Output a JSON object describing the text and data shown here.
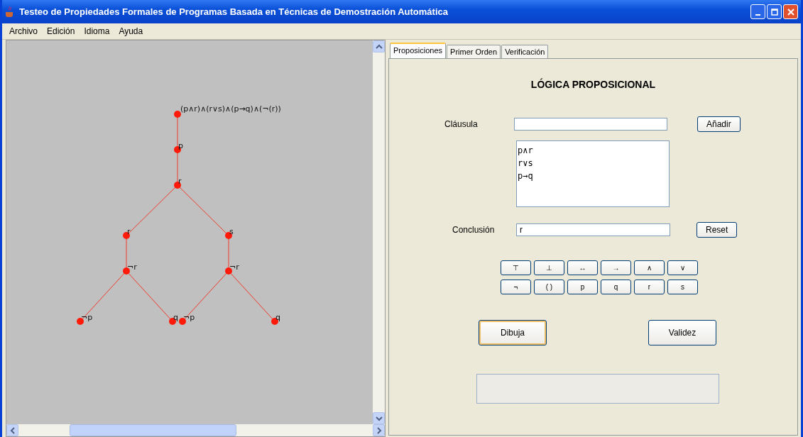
{
  "window": {
    "title": "Testeo de Propiedades Formales de Programas Basada en Técnicas de Demostración Automática"
  },
  "menu": [
    "Archivo",
    "Edición",
    "Idioma",
    "Ayuda"
  ],
  "tree": {
    "label": "(p∧r)∧(r∨s)∧(p→q)∧(¬(r))",
    "children": [
      {
        "label": "p",
        "children": [
          {
            "label": "r",
            "children": [
              {
                "label": "r",
                "children": [
                  {
                    "label": "¬r",
                    "children": [
                      {
                        "label": "¬p"
                      },
                      {
                        "label": "q"
                      }
                    ]
                  }
                ]
              },
              {
                "label": "s",
                "children": [
                  {
                    "label": "¬r",
                    "children": [
                      {
                        "label": "¬p"
                      },
                      {
                        "label": "q"
                      }
                    ]
                  }
                ]
              }
            ]
          }
        ]
      }
    ]
  },
  "tabs": [
    {
      "label": "Proposiciones",
      "selected": true
    },
    {
      "label": "Primer Orden",
      "selected": false
    },
    {
      "label": "Verificación",
      "selected": false
    }
  ],
  "heading": "LÓGICA PROPOSICIONAL",
  "clause": {
    "label": "Cláusula",
    "button": "Añadir"
  },
  "clauses": [
    "p∧r",
    "r∨s",
    "p→q"
  ],
  "conclusion": {
    "label": "Conclusión",
    "value": "r",
    "button": "Reset"
  },
  "symbol_rows": [
    [
      "⊤",
      "⊥",
      "↔",
      "→",
      "∧",
      "∨"
    ],
    [
      "¬",
      "( )",
      "p",
      "q",
      "r",
      "s"
    ]
  ],
  "actions": [
    {
      "label": "Dibuja",
      "selected": true
    },
    {
      "label": "Validez",
      "selected": false
    }
  ]
}
